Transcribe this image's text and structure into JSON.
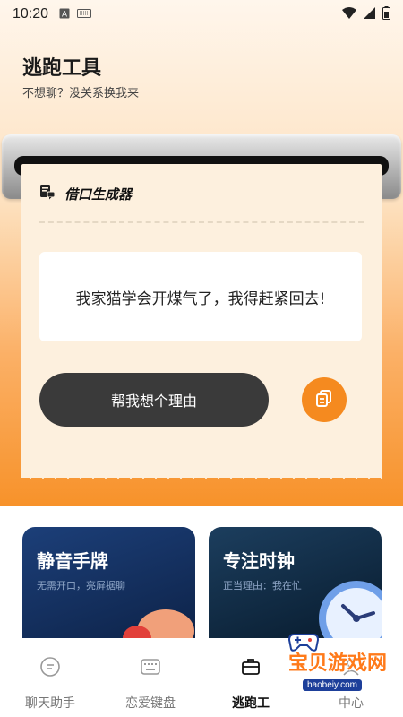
{
  "status_bar": {
    "time": "10:20"
  },
  "header": {
    "title": "逃跑工具",
    "subtitle": "不想聊？没关系换我来"
  },
  "generator": {
    "title": "借口生成器",
    "excuse": "我家猫学会开煤气了，我得赶紧回去!",
    "generate_label": "帮我想个理由"
  },
  "cards": [
    {
      "title": "静音手牌",
      "subtitle": "无需开口，亮屏据聊"
    },
    {
      "title": "专注时钟",
      "subtitle": "正当理由：我在忙"
    }
  ],
  "tabs": [
    {
      "label": "聊天助手",
      "icon": "chat-icon"
    },
    {
      "label": "恋爱键盘",
      "icon": "keyboard-icon"
    },
    {
      "label": "逃跑工",
      "icon": "briefcase-icon"
    },
    {
      "label": "中心",
      "icon": "user-icon"
    }
  ],
  "watermark": {
    "text": "宝贝游戏网",
    "url": "baobeiy.com"
  },
  "colors": {
    "accent": "#f58a1f",
    "dark_button": "#3a3a3a",
    "paper": "#fdf0de"
  }
}
